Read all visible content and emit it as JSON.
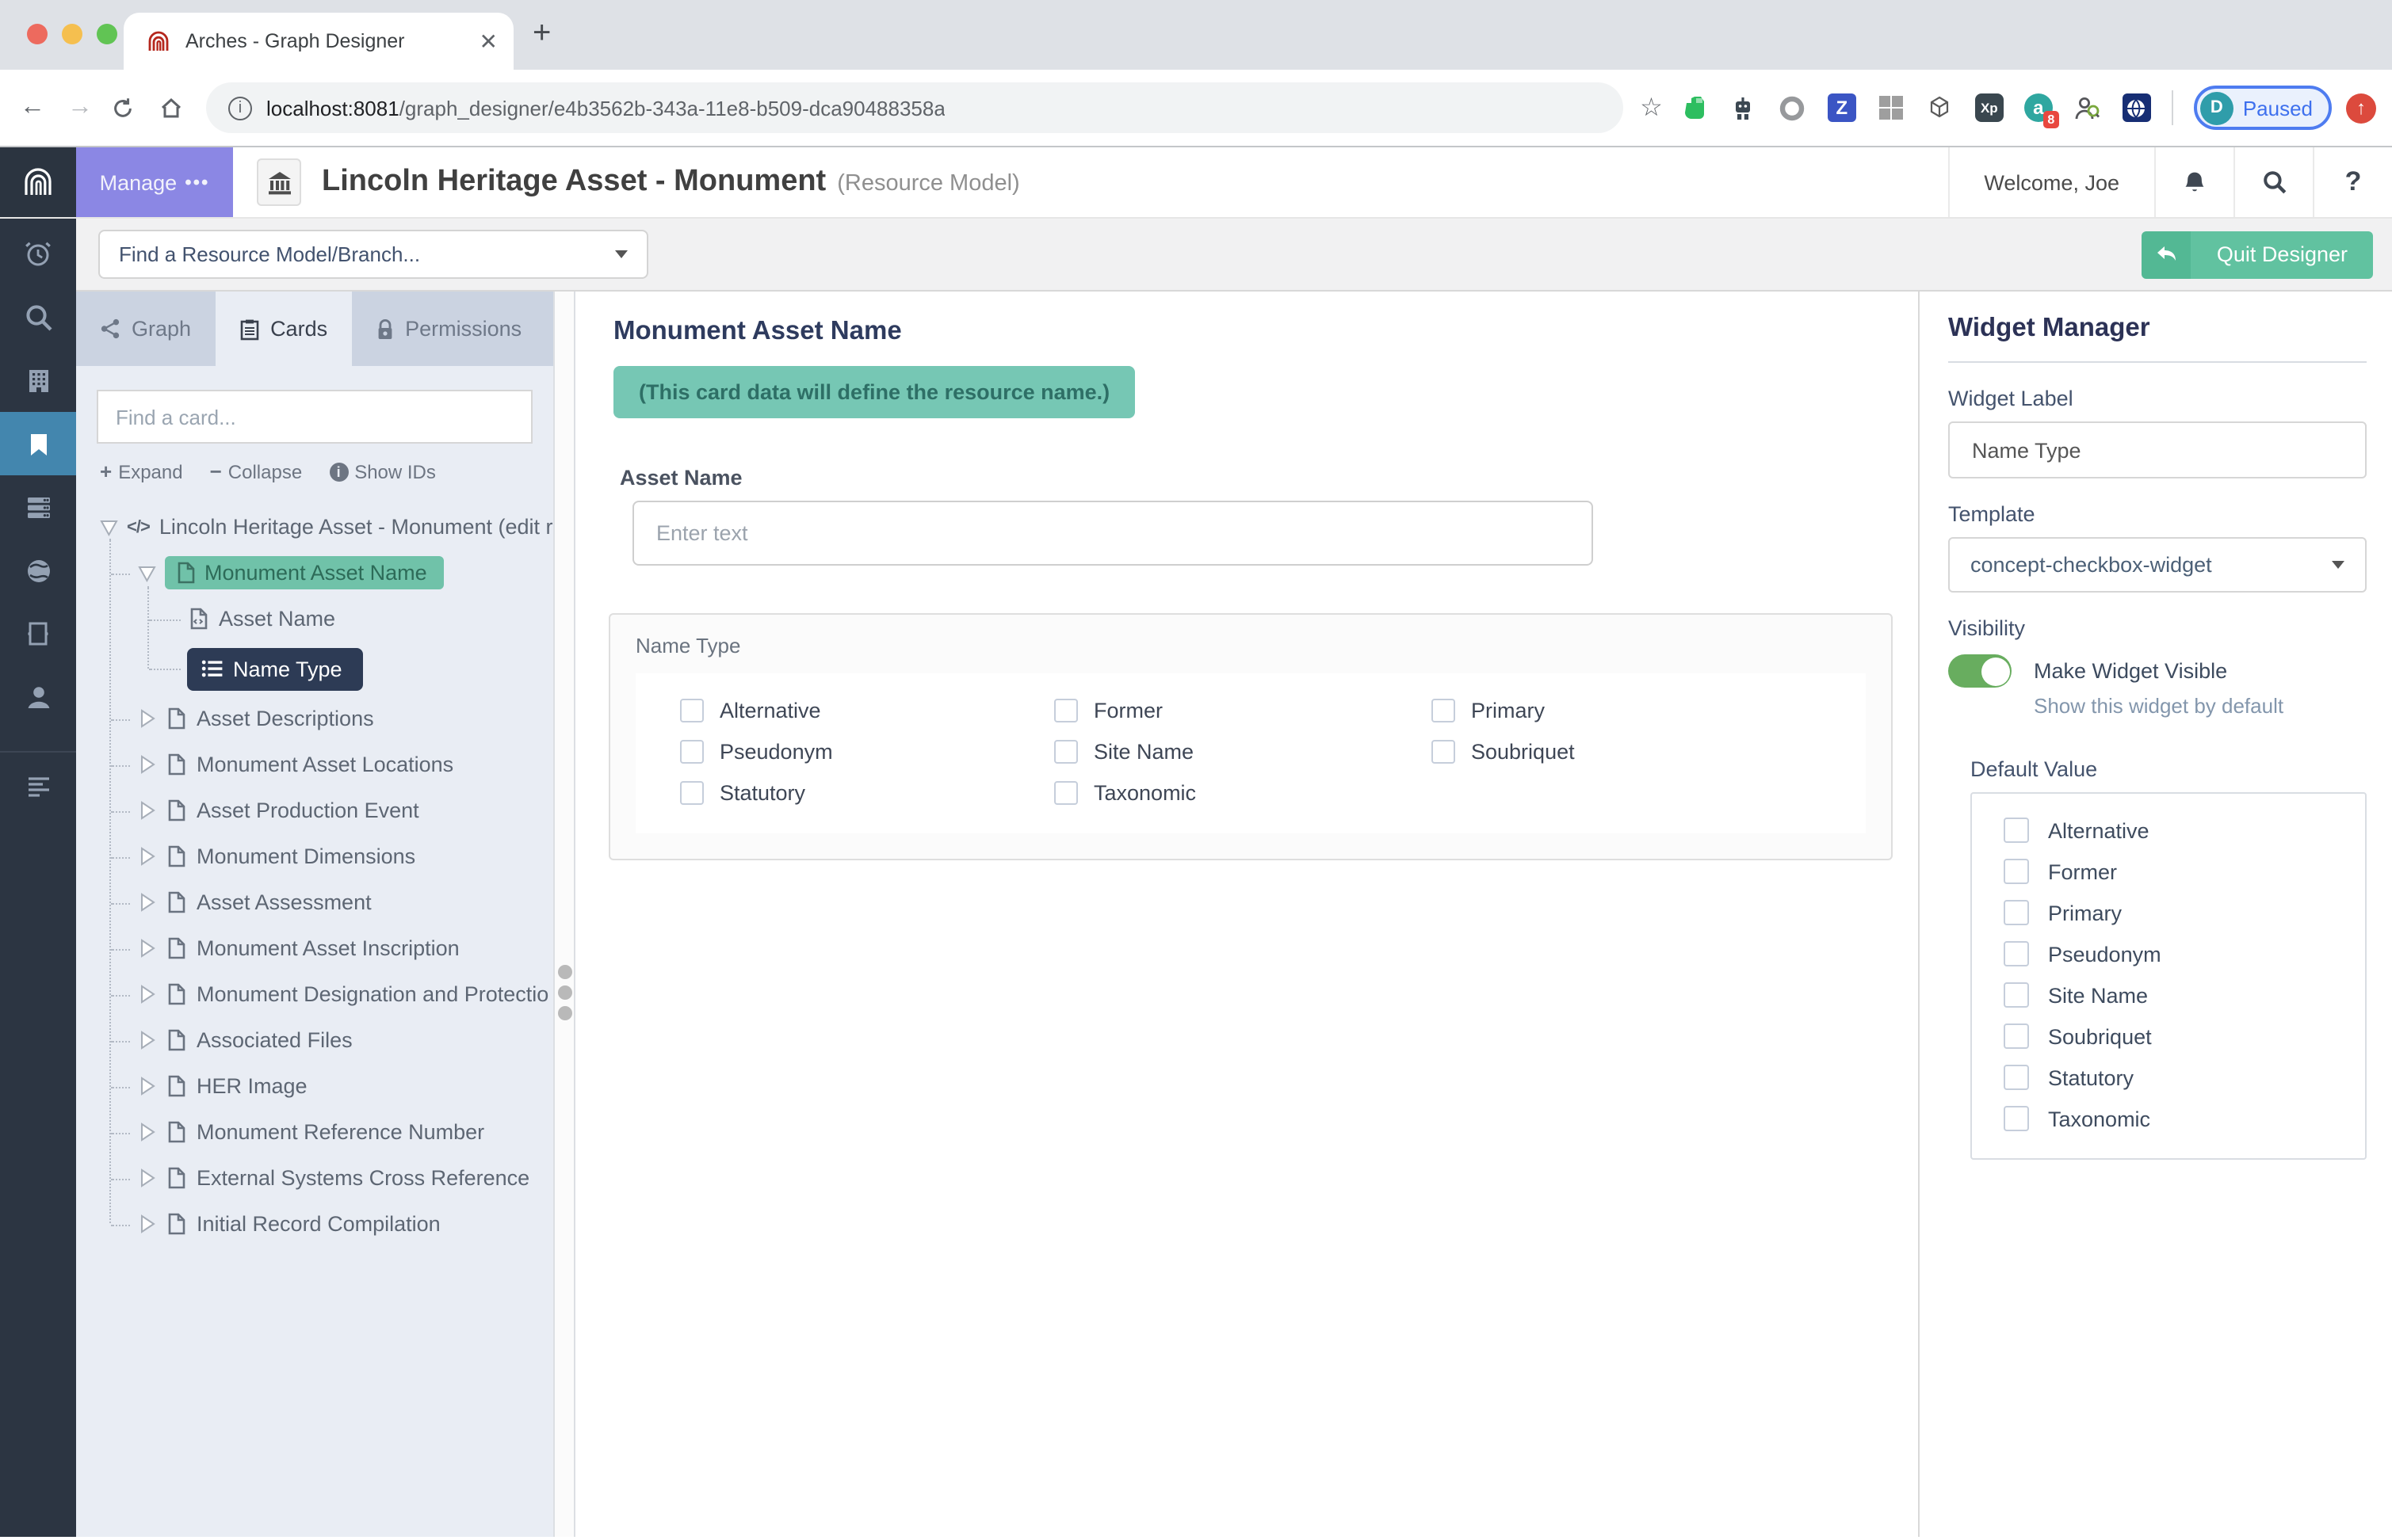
{
  "browser": {
    "tab_title": "Arches - Graph Designer",
    "url_host": "localhost:8081",
    "url_path": "/graph_designer/e4b3562b-343a-11e8-b509-dca90488358a",
    "paused_button": {
      "avatar_initial": "D",
      "label": "Paused"
    },
    "extension_badge_count": "8",
    "extension_icon_names": [
      "bookmark-star",
      "evernote",
      "robot",
      "ring",
      "zotero",
      "grid",
      "geojson",
      "xp",
      "a-extension",
      "person-search",
      "globe-extension",
      "profile-paused",
      "updater"
    ]
  },
  "header": {
    "manage_label": "Manage",
    "title": "Lincoln Heritage Asset - Monument",
    "subtitle": "(Resource Model)",
    "welcome": "Welcome, Joe"
  },
  "toolbar": {
    "find_model_placeholder": "Find a Resource Model/Branch...",
    "quit_label": "Quit Designer"
  },
  "tabs": {
    "graph": "Graph",
    "cards": "Cards",
    "permissions": "Permissions"
  },
  "card_panel": {
    "search_placeholder": "Find a card...",
    "expand_label": "Expand",
    "collapse_label": "Collapse",
    "show_ids_label": "Show IDs",
    "tree": [
      {
        "label": "Lincoln Heritage Asset - Monument (edit r"
      },
      {
        "label": "Monument Asset Name"
      },
      {
        "label": "Asset Name"
      },
      {
        "label": "Name Type"
      },
      {
        "label": "Asset Descriptions"
      },
      {
        "label": "Monument Asset Locations"
      },
      {
        "label": "Asset Production Event"
      },
      {
        "label": "Monument Dimensions"
      },
      {
        "label": "Asset Assessment"
      },
      {
        "label": "Monument Asset Inscription"
      },
      {
        "label": "Monument Designation and Protectio"
      },
      {
        "label": "Associated Files"
      },
      {
        "label": "HER Image"
      },
      {
        "label": "Monument Reference Number"
      },
      {
        "label": "External Systems Cross Reference"
      },
      {
        "label": "Initial Record Compilation"
      }
    ]
  },
  "main": {
    "card_title": "Monument Asset Name",
    "banner": "(This card data will define the resource name.)",
    "asset_name_label": "Asset Name",
    "asset_name_placeholder": "Enter text",
    "name_type_label": "Name Type",
    "name_type_options": [
      "Alternative",
      "Former",
      "Primary",
      "Pseudonym",
      "Site Name",
      "Soubriquet",
      "Statutory",
      "Taxonomic"
    ]
  },
  "widget_manager": {
    "title": "Widget Manager",
    "widget_label_label": "Widget Label",
    "widget_label_value": "Name Type",
    "template_label": "Template",
    "template_value": "concept-checkbox-widget",
    "visibility_label": "Visibility",
    "visible_toggle_label": "Make Widget Visible",
    "visible_toggle_sub": "Show this widget by default",
    "visible_toggle_on": true,
    "default_value_label": "Default Value",
    "default_options": [
      "Alternative",
      "Former",
      "Primary",
      "Pseudonym",
      "Site Name",
      "Soubriquet",
      "Statutory",
      "Taxonomic"
    ]
  },
  "colors": {
    "selected_node": "#2d3b55",
    "highlight_teal": "#70c2a9",
    "banner_teal": "#76c7b4",
    "manage_purple": "#8b87e4",
    "quit_green": "#61c2a0",
    "toggle_green": "#68ad5f",
    "sidebar_active_blue": "#4386ae",
    "sidebar_bg": "#2c3542"
  }
}
